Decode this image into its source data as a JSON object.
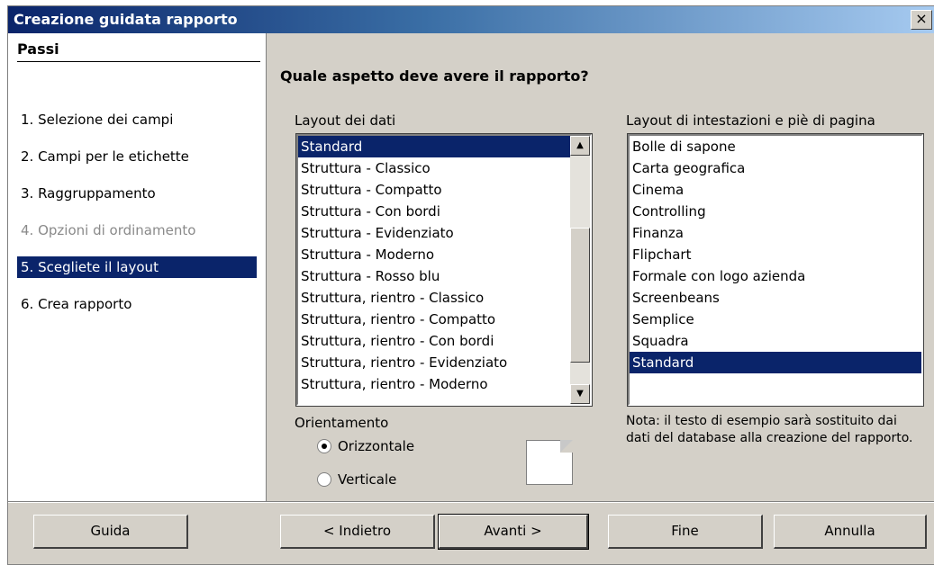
{
  "window": {
    "title": "Creazione guidata rapporto",
    "close_glyph": "×"
  },
  "steps": {
    "title": "Passi",
    "items": [
      {
        "label": "1.  Selezione dei campi",
        "state": "normal"
      },
      {
        "label": "2.  Campi per le etichette",
        "state": "normal"
      },
      {
        "label": "3.  Raggruppamento",
        "state": "normal"
      },
      {
        "label": "4.  Opzioni di ordinamento",
        "state": "disabled"
      },
      {
        "label": "5.  Scegliete il layout",
        "state": "active"
      },
      {
        "label": "6.  Crea rapporto",
        "state": "normal"
      }
    ]
  },
  "main": {
    "heading": "Quale aspetto deve avere il rapporto?",
    "data_layout": {
      "label": "Layout dei dati",
      "selected": "Standard",
      "items": [
        "Standard",
        "Struttura - Classico",
        "Struttura - Compatto",
        "Struttura - Con bordi",
        "Struttura - Evidenziato",
        "Struttura - Moderno",
        "Struttura - Rosso blu",
        "Struttura, rientro - Classico",
        "Struttura, rientro - Compatto",
        "Struttura, rientro - Con bordi",
        "Struttura, rientro - Evidenziato",
        "Struttura, rientro - Moderno"
      ]
    },
    "header_layout": {
      "label": "Layout di intestazioni e piè di pagina",
      "selected": "Standard",
      "items": [
        "Bolle di sapone",
        "Carta geografica",
        "Cinema",
        "Controlling",
        "Finanza",
        "Flipchart",
        "Formale con logo azienda",
        "Screenbeans",
        "Semplice",
        "Squadra",
        "Standard"
      ]
    },
    "orientation": {
      "label": "Orientamento",
      "options": [
        {
          "label": "Orizzontale",
          "checked": true
        },
        {
          "label": "Verticale",
          "checked": false
        }
      ]
    },
    "note": "Nota: il testo di esempio sarà sostituito dai dati del database alla creazione del rapporto."
  },
  "buttons": {
    "help": "Guida",
    "back": "< Indietro",
    "next": "Avanti >",
    "finish": "Fine",
    "cancel": "Annulla"
  },
  "colors": {
    "selection": "#0a246a",
    "dialog_bg": "#d4d0c8",
    "disabled_text": "#8a8a8a"
  }
}
